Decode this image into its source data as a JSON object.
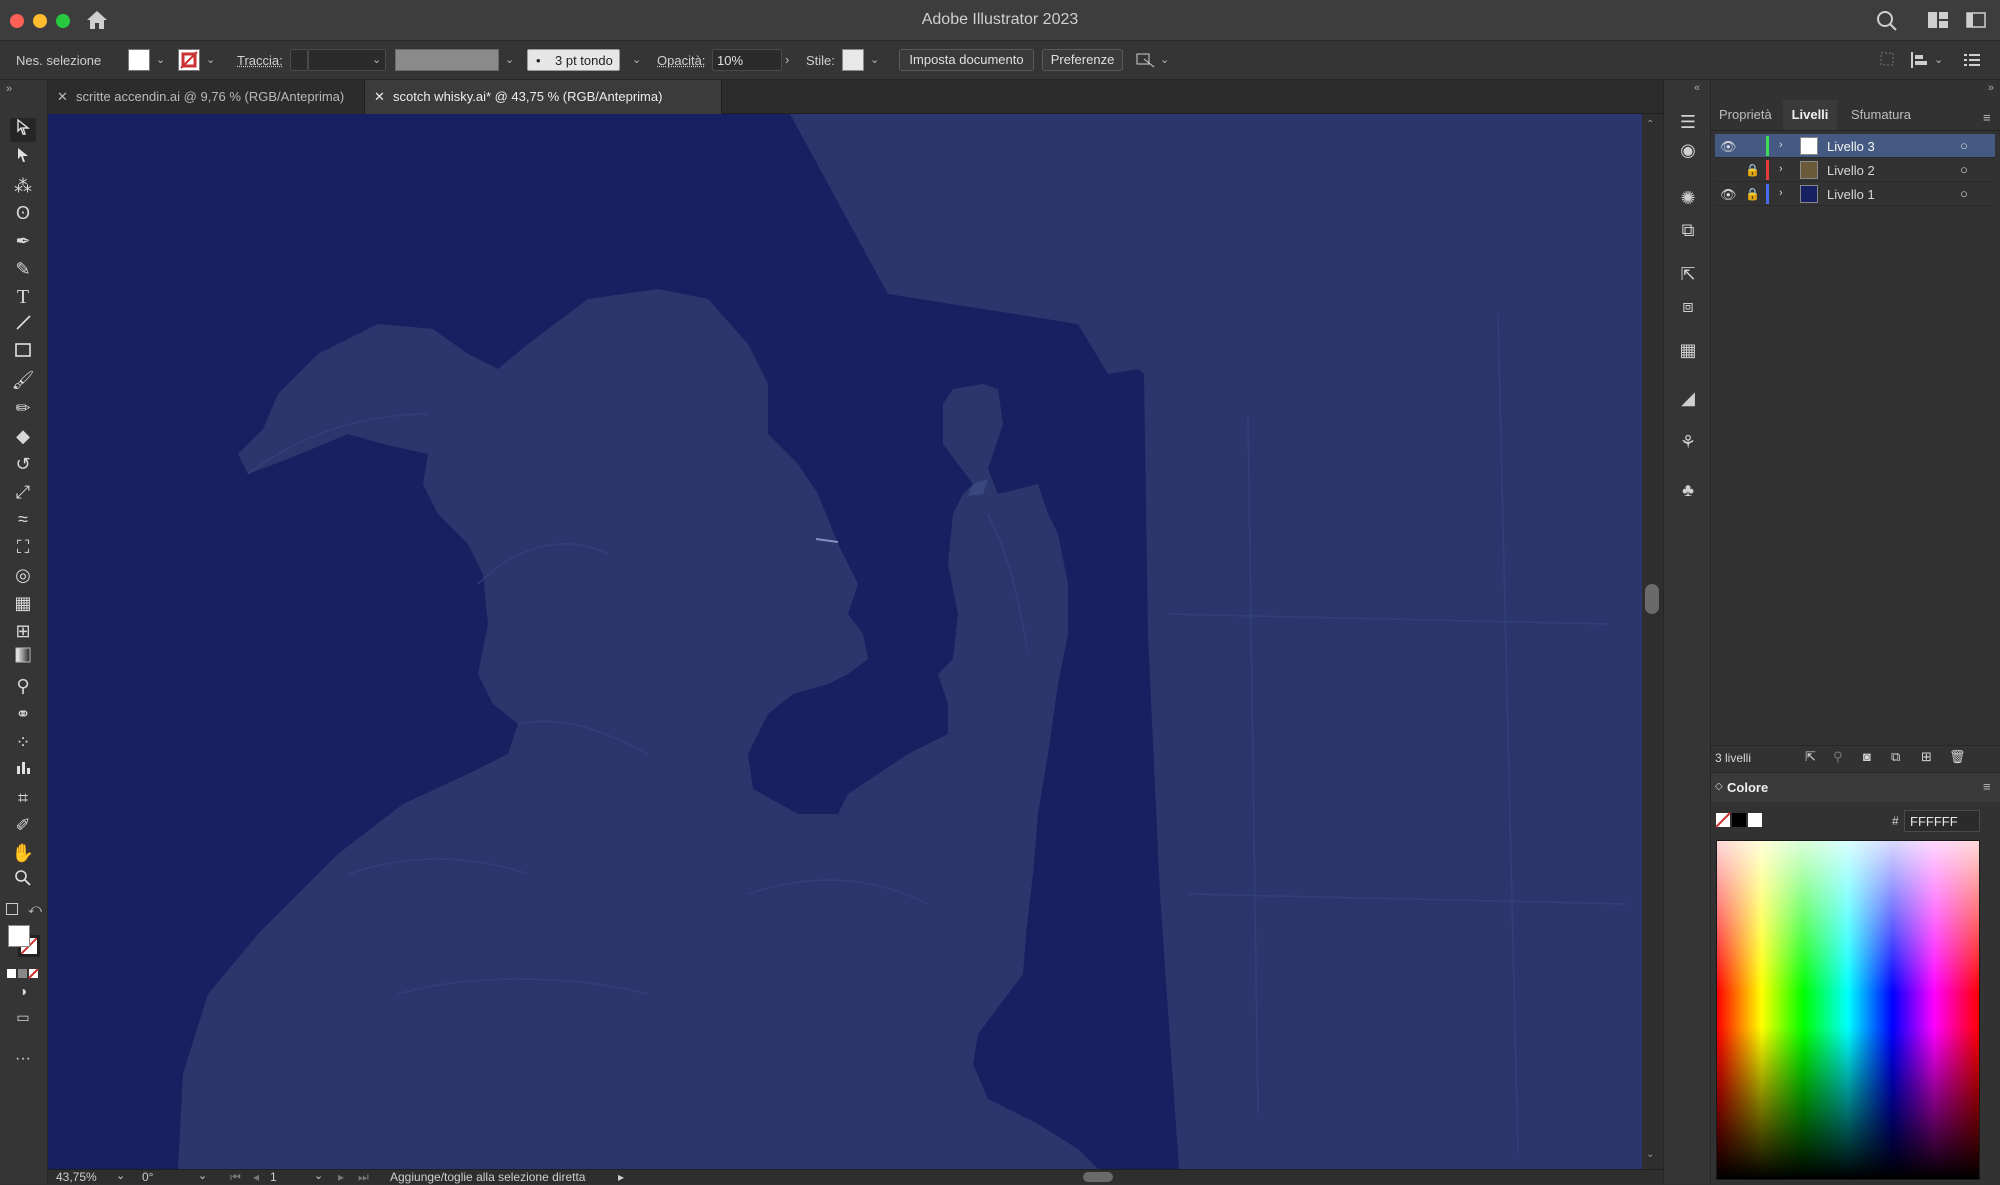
{
  "app": {
    "title": "Adobe Illustrator 2023"
  },
  "control_bar": {
    "selection_label": "Nes. selezione",
    "stroke_label": "Traccia:",
    "brush_value": "3 pt tondo",
    "opacity_label": "Opacità:",
    "opacity_value": "10%",
    "style_label": "Stile:",
    "document_setup_button": "Imposta documento",
    "preferences_button": "Preferenze"
  },
  "tabs": [
    {
      "label": "scritte accendin.ai @ 9,76 % (RGB/Anteprima)",
      "active": false
    },
    {
      "label": "scotch whisky.ai* @ 43,75 % (RGB/Anteprima)",
      "active": true
    }
  ],
  "status_bar": {
    "zoom": "43,75%",
    "rotation": "0°",
    "artboard": "1",
    "hint": "Aggiunge/toglie alla selezione diretta"
  },
  "panels": {
    "tabs": [
      "Proprietà",
      "Livelli",
      "Sfumatura"
    ],
    "active_tab": "Livelli",
    "layers": [
      {
        "name": "Livello 3",
        "visible": true,
        "locked": false,
        "color": "#3fdc5a",
        "thumb": "#ffffff",
        "selected": true
      },
      {
        "name": "Livello 2",
        "visible": false,
        "locked": true,
        "color": "#e53b3b",
        "thumb": "#6b5a3a",
        "selected": false
      },
      {
        "name": "Livello 1",
        "visible": true,
        "locked": true,
        "color": "#4a6cf0",
        "thumb": "#172161",
        "selected": false
      }
    ],
    "layer_count": "3 livelli",
    "color_panel": {
      "title": "Colore",
      "hex_label": "#",
      "hex_value": "FFFFFF"
    }
  },
  "colors": {
    "canvas_bg": "#172161",
    "shape_fill": "#2b376c",
    "accent": "#4a6cf0"
  }
}
